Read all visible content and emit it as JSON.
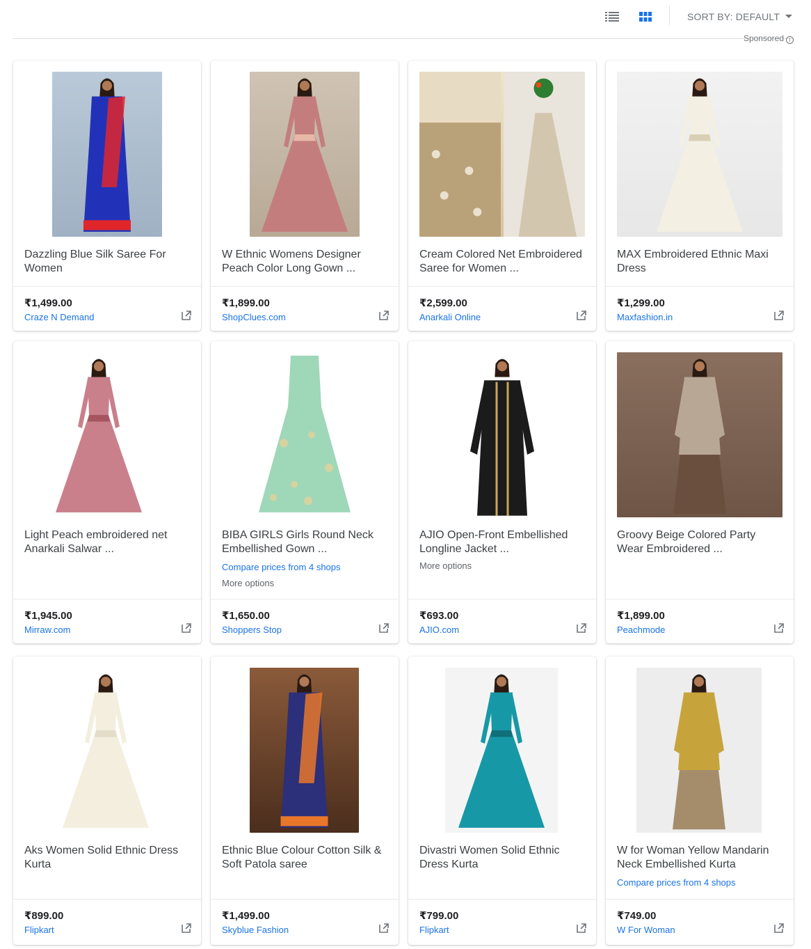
{
  "toolbar": {
    "sort_label": "SORT BY: DEFAULT",
    "sponsored_label": "Sponsored",
    "info_glyph": "i"
  },
  "colors": {
    "accent": "#1a73e8",
    "active_view": "#1a73e8",
    "muted": "#70757a"
  },
  "products": [
    {
      "title": "Dazzling Blue Silk Saree For Women",
      "price": "₹1,499.00",
      "seller": "Craze N Demand"
    },
    {
      "title": "W Ethnic Womens Designer Peach Color Long Gown ...",
      "price": "₹1,899.00",
      "seller": "ShopClues.com"
    },
    {
      "title": "Cream Colored Net Embroidered Saree for Women ...",
      "price": "₹2,599.00",
      "seller": "Anarkali Online"
    },
    {
      "title": "MAX Embroidered Ethnic Maxi Dress",
      "price": "₹1,299.00",
      "seller": "Maxfashion.in"
    },
    {
      "title": "Light Peach embroidered net Anarkali Salwar ...",
      "price": "₹1,945.00",
      "seller": "Mirraw.com"
    },
    {
      "title": "BIBA GIRLS Girls Round Neck Embellished Gown ...",
      "compare": "Compare prices from 4 shops",
      "more": "More options",
      "price": "₹1,650.00",
      "seller": "Shoppers Stop"
    },
    {
      "title": "AJIO Open-Front Embellished Longline Jacket ...",
      "more": "More options",
      "price": "₹693.00",
      "seller": "AJIO.com"
    },
    {
      "title": "Groovy Beige Colored Party Wear Embroidered ...",
      "price": "₹1,899.00",
      "seller": "Peachmode"
    },
    {
      "title": "Aks Women Solid Ethnic Dress Kurta",
      "price": "₹899.00",
      "seller": "Flipkart"
    },
    {
      "title": "Ethnic Blue Colour Cotton Silk & Soft Patola saree",
      "price": "₹1,499.00",
      "seller": "Skyblue Fashion"
    },
    {
      "title": "Divastri Women Solid Ethnic Dress Kurta",
      "price": "₹799.00",
      "seller": "Flipkart"
    },
    {
      "title": "W for Woman Yellow Mandarin Neck Embellished Kurta",
      "compare": "Compare prices from 4 shops",
      "price": "₹749.00",
      "seller": "W For Woman"
    }
  ],
  "icons": {
    "list_view": "list-view-icon",
    "grid_view": "grid-view-icon",
    "external": "external-link-icon",
    "info": "info-icon",
    "sort": "dropdown-caret-icon"
  }
}
